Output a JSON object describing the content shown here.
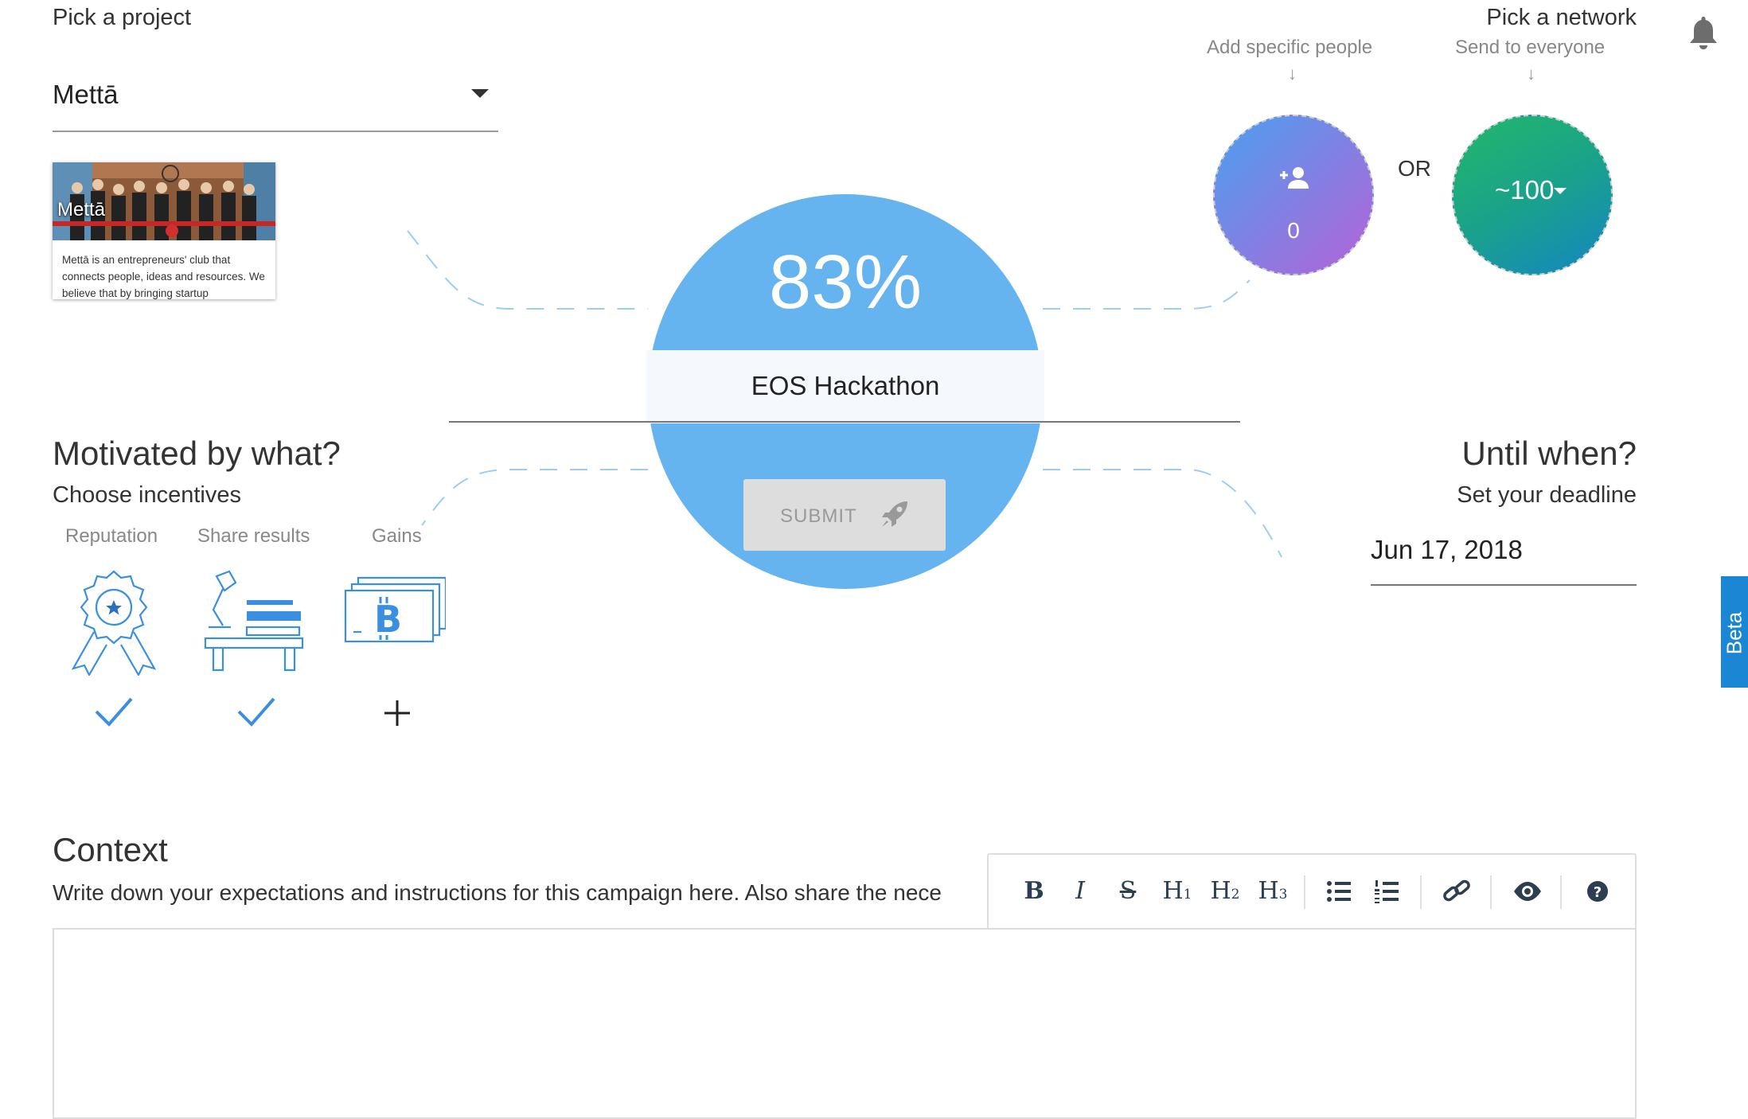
{
  "project": {
    "label": "Pick a project",
    "selected": "Mettā",
    "card": {
      "title": "Mettā",
      "description": "Mettā is an entrepreneurs' club that connects people, ideas and resources. We believe that by bringing startup"
    }
  },
  "network": {
    "label": "Pick a network",
    "add_people_label": "Add specific people",
    "send_everyone_label": "Send to everyone",
    "arrow": "↓",
    "people_count": "0",
    "or_label": "OR",
    "network_size": "~100"
  },
  "campaign": {
    "progress": "83%",
    "title": "EOS Hackathon",
    "submit_label": "SUBMIT"
  },
  "incentives": {
    "heading": "Motivated by what?",
    "subheading": "Choose incentives",
    "items": [
      {
        "label": "Reputation",
        "icon": "ribbon-medal-icon",
        "state": "✓",
        "selected": true
      },
      {
        "label": "Share results",
        "icon": "desk-lamp-icon",
        "state": "✓",
        "selected": true
      },
      {
        "label": "Gains",
        "icon": "bitcoin-bills-icon",
        "state": "+",
        "selected": false
      }
    ]
  },
  "deadline": {
    "heading": "Until when?",
    "subheading": "Set your deadline",
    "value": "Jun 17, 2018"
  },
  "beta_label": "Beta",
  "context": {
    "heading": "Context",
    "description": "Write down your expectations and instructions for this campaign here. Also share the nece",
    "toolbar": {
      "bold": "B",
      "italic": "I",
      "strikethrough": "S",
      "h1": "H",
      "h2": "H",
      "h3": "H",
      "h1_sub": "1",
      "h2_sub": "2",
      "h3_sub": "3"
    }
  },
  "colors": {
    "accent_blue": "#66b4ef",
    "people_gradient": [
      "#4aa0f0",
      "#b561d8"
    ],
    "network_gradient": [
      "#22b86a",
      "#1486c2"
    ],
    "check_blue": "#3b8fe0",
    "beta_tab": "#1a86d4"
  }
}
